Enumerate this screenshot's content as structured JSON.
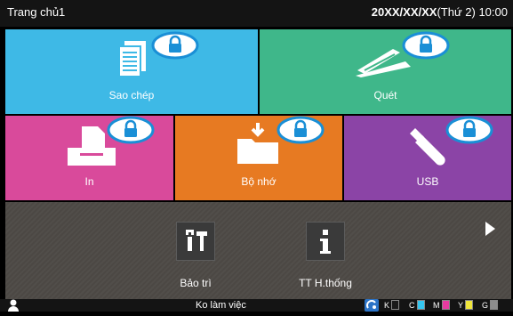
{
  "header": {
    "title": "Trang chủ1",
    "date": "20XX/XX/XX",
    "weekday": "(Thứ 2)",
    "time": "10:00"
  },
  "tiles": {
    "copy": {
      "label": "Sao chép",
      "color": "#3eb9e6"
    },
    "scan": {
      "label": "Quét",
      "color": "#3fb78a"
    },
    "print": {
      "label": "In",
      "color": "#d94a9b"
    },
    "storage": {
      "label": "Bộ nhớ",
      "color": "#e77a22"
    },
    "usb": {
      "label": "USB",
      "color": "#8b44a6"
    }
  },
  "tools": {
    "maintenance": {
      "label": "Bảo trì",
      "icon": "tools-icon"
    },
    "system_info": {
      "label": "TT H.thống",
      "icon": "info-icon"
    }
  },
  "status": {
    "mode_label": "Ko làm việc",
    "inks": [
      {
        "tag": "K",
        "color": "#1a1a1a"
      },
      {
        "tag": "C",
        "color": "#35c6f0"
      },
      {
        "tag": "M",
        "color": "#e63ba0"
      },
      {
        "tag": "Y",
        "color": "#f0e63c"
      },
      {
        "tag": "G",
        "color": "#8c8c8c"
      }
    ]
  },
  "lock_icon_color": "#1a8fd6"
}
